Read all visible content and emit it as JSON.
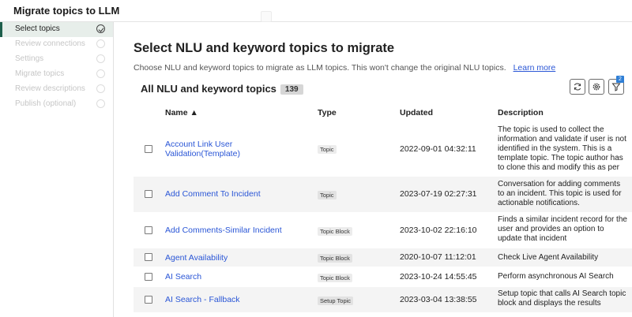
{
  "window": {
    "title": "Migrate topics to LLM"
  },
  "sidebar": {
    "steps": [
      {
        "label": "Select topics"
      },
      {
        "label": "Review connections"
      },
      {
        "label": "Settings"
      },
      {
        "label": "Migrate topics"
      },
      {
        "label": "Review descriptions"
      },
      {
        "label": "Publish (optional)"
      }
    ]
  },
  "main": {
    "heading": "Select NLU and keyword topics to migrate",
    "subtitle": "Choose NLU and keyword topics to migrate as LLM topics. This won't change the original NLU topics.",
    "learn_more": "Learn more",
    "list_title": "All NLU and keyword topics",
    "list_count": "139",
    "filter_badge": "2",
    "columns": {
      "name": "Name ▲",
      "type": "Type",
      "updated": "Updated",
      "description": "Description"
    },
    "rows": [
      {
        "name": "Account Link User Validation(Template)",
        "type": "Topic",
        "updated": "2022-09-01 04:32:11",
        "description": "The topic is used to collect the information and validate if user is not identified in the system. This is a template topic. The topic author has to clone this and modify this as per ..."
      },
      {
        "name": "Add Comment To Incident",
        "type": "Topic",
        "updated": "2023-07-19 02:27:31",
        "description": "Conversation for adding comments to an incident. This topic is used for actionable notifications."
      },
      {
        "name": "Add Comments-Similar Incident",
        "type": "Topic Block",
        "updated": "2023-10-02 22:16:10",
        "description": "Finds a similar incident record for the user and provides an option to update that incident"
      },
      {
        "name": "Agent Availability",
        "type": "Topic Block",
        "updated": "2020-10-07 11:12:01",
        "description": "Check Live Agent Availability"
      },
      {
        "name": "AI Search",
        "type": "Topic Block",
        "updated": "2023-10-24 14:55:45",
        "description": "Perform asynchronous AI Search"
      },
      {
        "name": "AI Search - Fallback",
        "type": "Setup Topic",
        "updated": "2023-03-04 13:38:55",
        "description": "Setup topic that calls AI Search topic block and displays the results"
      }
    ]
  },
  "icons": {
    "refresh": "refresh-icon",
    "settings": "gear-icon",
    "filter": "filter-icon"
  },
  "colors": {
    "link": "#2a56d6",
    "active_step": "#1e5f4c",
    "badge": "#2f7fd6"
  }
}
